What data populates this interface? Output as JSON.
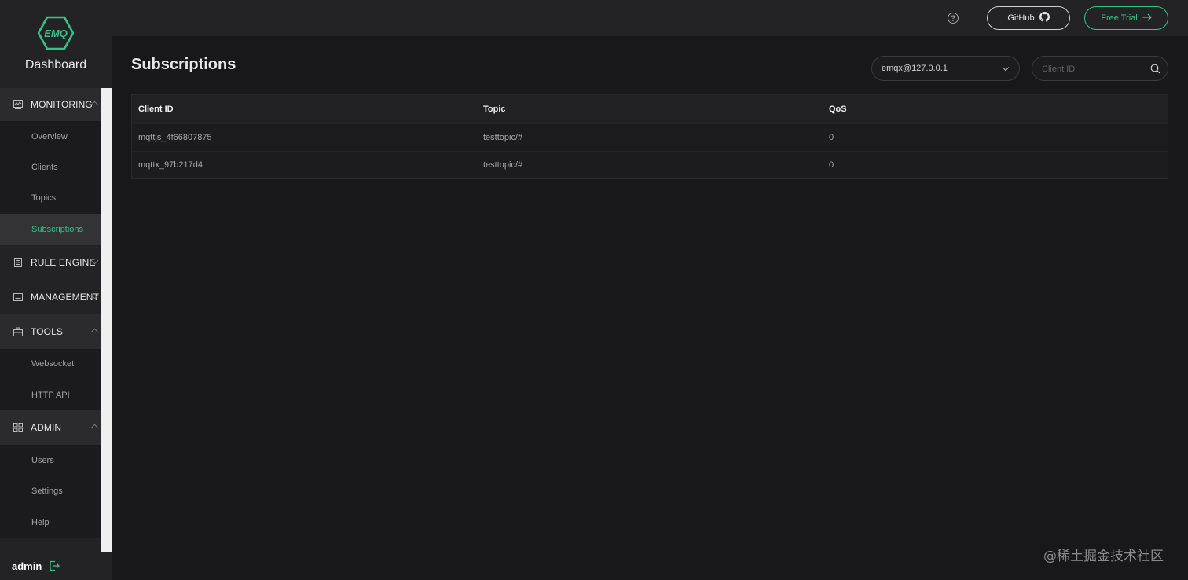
{
  "brand": {
    "logo_text": "EMQ",
    "title": "Dashboard"
  },
  "sidebar": {
    "groups": [
      {
        "label": "MONITORING",
        "icon": "monitor-icon",
        "items": [
          "Overview",
          "Clients",
          "Topics",
          "Subscriptions"
        ]
      },
      {
        "label": "RULE ENGINE",
        "icon": "rule-icon"
      },
      {
        "label": "MANAGEMENT",
        "icon": "management-icon"
      },
      {
        "label": "TOOLS",
        "icon": "toolbox-icon",
        "items": [
          "Websocket",
          "HTTP API"
        ]
      },
      {
        "label": "ADMIN",
        "icon": "admin-icon",
        "items": [
          "Users",
          "Settings",
          "Help"
        ]
      }
    ],
    "active_item": "Subscriptions"
  },
  "user": {
    "name": "admin"
  },
  "topbar": {
    "github_label": "GitHub",
    "trial_label": "Free Trial"
  },
  "page": {
    "title": "Subscriptions"
  },
  "filters": {
    "node": "emqx@127.0.0.1",
    "client_id_placeholder": "Client ID"
  },
  "table": {
    "headers": [
      "Client ID",
      "Topic",
      "QoS"
    ],
    "rows": [
      [
        "mqttjs_4f66807875",
        "testtopic/#",
        "0"
      ],
      [
        "mqttx_97b217d4",
        "testtopic/#",
        "0"
      ]
    ]
  },
  "watermark": "@稀土掘金技术社区",
  "colors": {
    "accent": "#34c388",
    "background": "#18181a",
    "sidebar": "#232325"
  }
}
